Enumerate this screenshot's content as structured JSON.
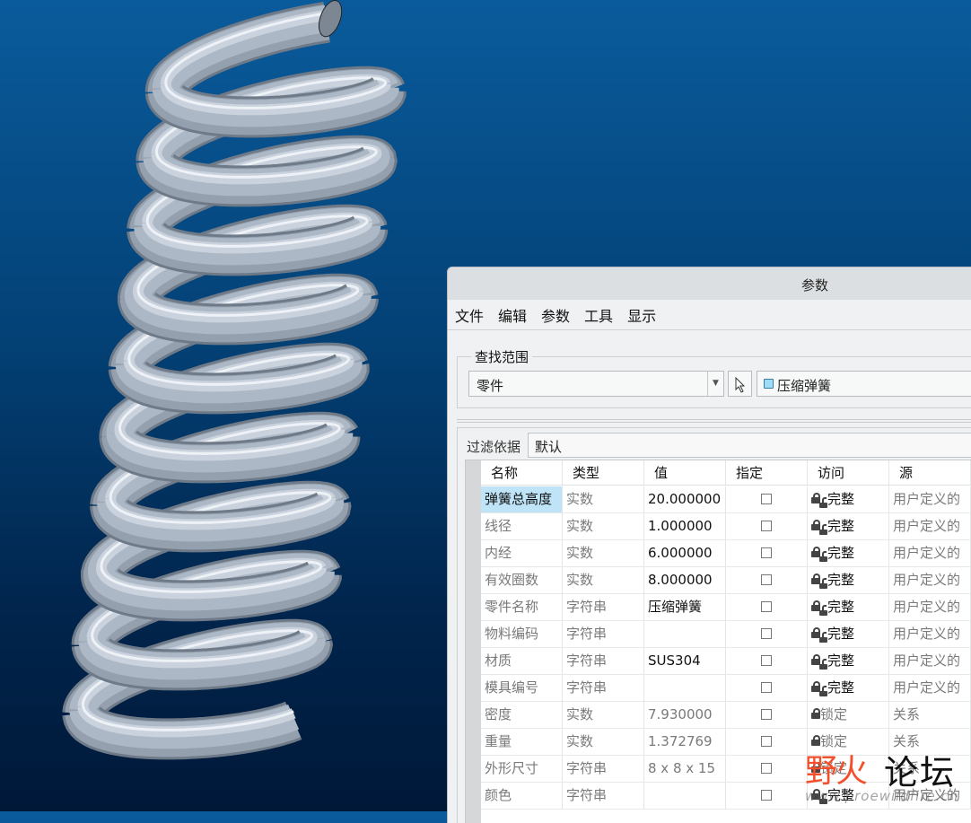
{
  "viewport": {
    "model": "compression-spring",
    "tube_color": "#a9b4c2",
    "bg_top": "#0a5b9c",
    "bg_bottom": "#001838"
  },
  "dialog": {
    "title": "参数",
    "menu": [
      "文件",
      "编辑",
      "参数",
      "工具",
      "显示"
    ],
    "scope": {
      "label": "查找范围",
      "type_value": "零件",
      "part_name": "压缩弹簧"
    },
    "filter": {
      "label": "过滤依据",
      "value": "默认"
    },
    "table": {
      "headers": [
        "名称",
        "类型",
        "值",
        "指定",
        "访问",
        "源"
      ],
      "rows": [
        {
          "name": "弹簧总高度",
          "type": "实数",
          "value": "20.000000",
          "designate": false,
          "access": "完整",
          "source": "用户定义的",
          "selected": true,
          "locked": false
        },
        {
          "name": "线径",
          "type": "实数",
          "value": "1.000000",
          "designate": false,
          "access": "完整",
          "source": "用户定义的",
          "locked": false
        },
        {
          "name": "内经",
          "type": "实数",
          "value": "6.000000",
          "designate": false,
          "access": "完整",
          "source": "用户定义的",
          "locked": false
        },
        {
          "name": "有效圈数",
          "type": "实数",
          "value": "8.000000",
          "designate": false,
          "access": "完整",
          "source": "用户定义的",
          "locked": false
        },
        {
          "name": "零件名称",
          "type": "字符串",
          "value": "压缩弹簧",
          "designate": false,
          "access": "完整",
          "source": "用户定义的",
          "locked": false
        },
        {
          "name": "物料编码",
          "type": "字符串",
          "value": "",
          "designate": false,
          "access": "完整",
          "source": "用户定义的",
          "locked": false
        },
        {
          "name": "材质",
          "type": "字符串",
          "value": "SUS304",
          "designate": false,
          "access": "完整",
          "source": "用户定义的",
          "locked": false
        },
        {
          "name": "模具编号",
          "type": "字符串",
          "value": "",
          "designate": false,
          "access": "完整",
          "source": "用户定义的",
          "locked": false
        },
        {
          "name": "密度",
          "type": "实数",
          "value": "7.930000",
          "designate": false,
          "access": "锁定",
          "source": "关系",
          "locked": true
        },
        {
          "name": "重量",
          "type": "实数",
          "value": "1.372769",
          "designate": false,
          "access": "锁定",
          "source": "关系",
          "locked": true
        },
        {
          "name": "外形尺寸",
          "type": "字符串",
          "value": "8 x 8 x 15",
          "designate": false,
          "access": "锁定",
          "source": "关系",
          "locked": true
        },
        {
          "name": "颜色",
          "type": "字符串",
          "value": "",
          "designate": false,
          "access": "完整",
          "source": "用户定义的",
          "locked": false
        }
      ]
    }
  },
  "watermark": {
    "brand_a": "野火",
    "brand_b": "论坛",
    "url": "www.proewildfire.cn"
  }
}
